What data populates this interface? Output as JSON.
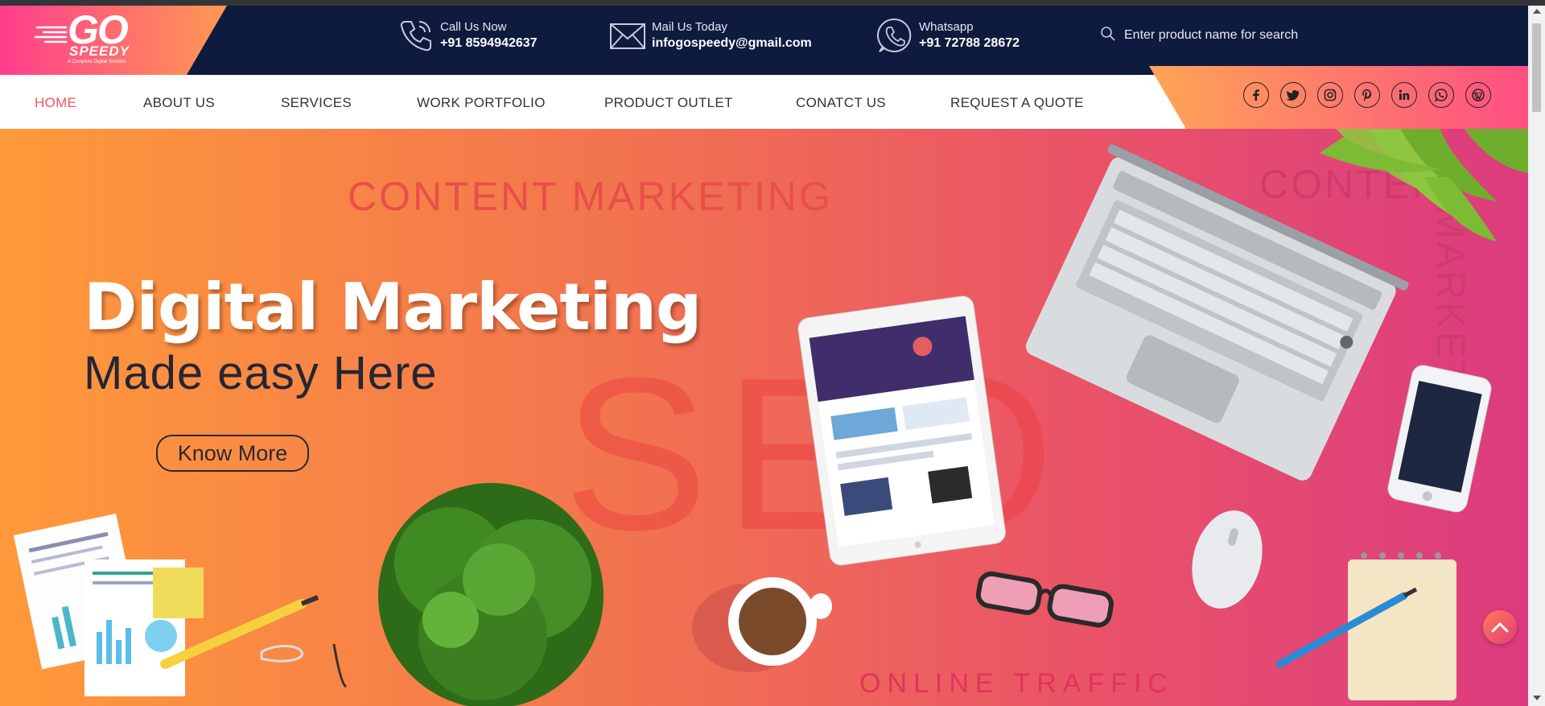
{
  "logo": {
    "brand": "GO",
    "brand2": "SPEEDY",
    "tagline": "A Complete Digital Solution"
  },
  "contacts": [
    {
      "label": "Call Us Now",
      "value": "+91 8594942637",
      "icon": "phone-icon"
    },
    {
      "label": "Mail Us Today",
      "value": "infogospeedy@gmail.com",
      "icon": "mail-icon"
    },
    {
      "label": "Whatsapp",
      "value": "+91 72788 28672",
      "icon": "whatsapp-icon"
    }
  ],
  "search": {
    "placeholder": "Enter product name for search"
  },
  "nav": [
    {
      "label": "HOME",
      "active": true
    },
    {
      "label": "ABOUT US"
    },
    {
      "label": "SERVICES"
    },
    {
      "label": "WORK PORTFOLIO"
    },
    {
      "label": "PRODUCT OUTLET"
    },
    {
      "label": "CONATCT US"
    },
    {
      "label": "REQUEST A QUOTE"
    }
  ],
  "social": [
    "facebook-icon",
    "twitter-icon",
    "instagram-icon",
    "pinterest-icon",
    "linkedin-icon",
    "whatsapp-icon",
    "wordpress-icon"
  ],
  "hero": {
    "title": "Digital Marketing",
    "subtitle": "Made easy Here",
    "button": "Know More",
    "bg_word_1": "CONTENT MARKETING",
    "bg_word_2": "CONTENT",
    "bg_word_vertical": "MARKETING",
    "bg_seo": "SEO",
    "bg_word_3": "ONLINE TRAFFIC"
  },
  "colors": {
    "topbar": "#0f1a3f",
    "accent_pink": "#ff3d8d",
    "accent_orange": "#ff9a52",
    "nav_active": "#f0565e"
  }
}
